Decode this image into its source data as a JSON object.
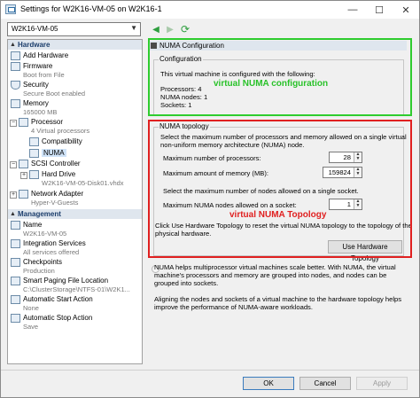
{
  "window": {
    "title": "Settings for W2K16-VM-05 on W2K16-1",
    "controls": {
      "minimize": "—",
      "maximize": "☐",
      "close": "✕"
    }
  },
  "toolbar": {
    "vm_name": "W2K16-VM-05",
    "back_glyph": "◀",
    "forward_glyph": "▶",
    "refresh_glyph": "⟳"
  },
  "sidebar": {
    "hardware_header": "Hardware",
    "management_header": "Management",
    "hardware_items": [
      {
        "label": "Add Hardware",
        "sub": ""
      },
      {
        "label": "Firmware",
        "sub": "Boot from File"
      },
      {
        "label": "Security",
        "sub": "Secure Boot enabled"
      },
      {
        "label": "Memory",
        "sub": "165000 MB"
      },
      {
        "label": "Processor",
        "sub": "4 Virtual processors"
      },
      {
        "label": "Compatibility",
        "sub": ""
      },
      {
        "label": "NUMA",
        "sub": ""
      },
      {
        "label": "SCSI Controller",
        "sub": ""
      },
      {
        "label": "Hard Drive",
        "sub": "W2K16-VM-05-Disk01.vhdx"
      },
      {
        "label": "Network Adapter",
        "sub": "Hyper-V-Guests"
      }
    ],
    "management_items": [
      {
        "label": "Name",
        "sub": "W2K16-VM-05"
      },
      {
        "label": "Integration Services",
        "sub": "All services offered"
      },
      {
        "label": "Checkpoints",
        "sub": "Production"
      },
      {
        "label": "Smart Paging File Location",
        "sub": "C:\\ClusterStorage\\NTFS-01\\W2K1..."
      },
      {
        "label": "Automatic Start Action",
        "sub": "None"
      },
      {
        "label": "Automatic Stop Action",
        "sub": "Save"
      }
    ]
  },
  "numa_config": {
    "header": "NUMA Configuration",
    "group_title": "Configuration",
    "intro": "This virtual machine is configured with the following:",
    "processors": "Processors: 4",
    "numa_nodes": "NUMA nodes: 1",
    "sockets": "Sockets: 1"
  },
  "numa_topology": {
    "group_title": "NUMA topology",
    "desc1": "Select the maximum number of processors and memory allowed on a single virtual",
    "desc2": "non-uniform memory architecture (NUMA) node.",
    "max_processors_label": "Maximum number of processors:",
    "max_processors_value": "28",
    "max_memory_label": "Maximum amount of memory (MB):",
    "max_memory_value": "159824",
    "nodes_desc": "Select the maximum number of nodes allowed on a single socket.",
    "max_nodes_label": "Maximum NUMA nodes allowed on a socket:",
    "max_nodes_value": "1",
    "hw_desc1": "Click Use Hardware Topology to reset the virtual NUMA topology to the topology of the",
    "hw_desc2": "physical hardware.",
    "use_hw_button": "Use Hardware Topology"
  },
  "info": {
    "para1_line1": "NUMA helps multiprocessor virtual machines scale better.  With NUMA, the virtual",
    "para1_line2": "machine's processors and memory are grouped into nodes, and nodes can be",
    "para1_line3": "grouped into sockets.",
    "para2_line1": "Aligning the nodes and sockets of a virtual machine to the hardware topology helps",
    "para2_line2": "improve the performance of NUMA-aware workloads."
  },
  "annotations": {
    "green_label": "virtual NUMA configuration",
    "green_color": "#2ecc2e",
    "red_label": "virtual NUMA Topology",
    "red_color": "#e02020"
  },
  "footer": {
    "ok": "OK",
    "cancel": "Cancel",
    "apply": "Apply"
  }
}
